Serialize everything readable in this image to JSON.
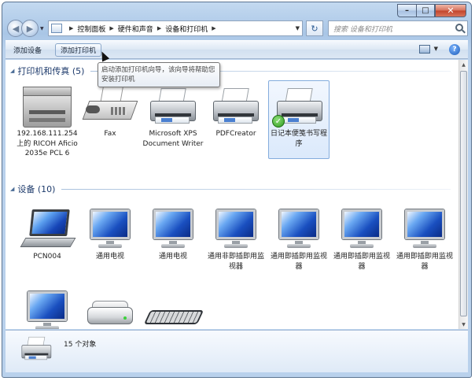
{
  "breadcrumb": [
    "控制面板",
    "硬件和声音",
    "设备和打印机"
  ],
  "search": {
    "placeholder": "搜索 设备和打印机"
  },
  "toolbar": {
    "add_device": "添加设备",
    "add_printer": "添加打印机"
  },
  "tooltip": {
    "text": "启动添加打印机向导，该向导将帮助您安装打印机"
  },
  "groups": {
    "printers": {
      "title": "打印机和传真 (5)",
      "items": [
        {
          "label": "192.168.111.254 上的 RICOH Aficio 2035e PCL 6",
          "icon": "multifunction-printer-icon"
        },
        {
          "label": "Fax",
          "icon": "fax-icon"
        },
        {
          "label": "Microsoft XPS Document Writer",
          "icon": "printer-icon"
        },
        {
          "label": "PDFCreator",
          "icon": "printer-icon"
        },
        {
          "label": "日记本便笺书写程序",
          "icon": "printer-icon",
          "default": true
        }
      ]
    },
    "devices": {
      "title": "设备 (10)",
      "items": [
        {
          "label": "PCN004",
          "icon": "laptop-icon"
        },
        {
          "label": "通用电视",
          "icon": "monitor-icon"
        },
        {
          "label": "通用电视",
          "icon": "monitor-icon"
        },
        {
          "label": "通用非即插即用监视器",
          "icon": "monitor-icon"
        },
        {
          "label": "通用即插即用监视器",
          "icon": "monitor-icon"
        },
        {
          "label": "通用即插即用监视器",
          "icon": "monitor-icon"
        },
        {
          "label": "通用即插即用监视器",
          "icon": "monitor-icon"
        },
        {
          "label": "",
          "icon": "monitor-icon"
        },
        {
          "label": "",
          "icon": "external-drive-icon"
        },
        {
          "label": "",
          "icon": "keyboard-icon"
        }
      ]
    }
  },
  "details": {
    "count_text": "15 个对象"
  },
  "colors": {
    "accent": "#1d3a6b",
    "selection": "#84acdd",
    "window_frame": "#a9c6e6"
  }
}
